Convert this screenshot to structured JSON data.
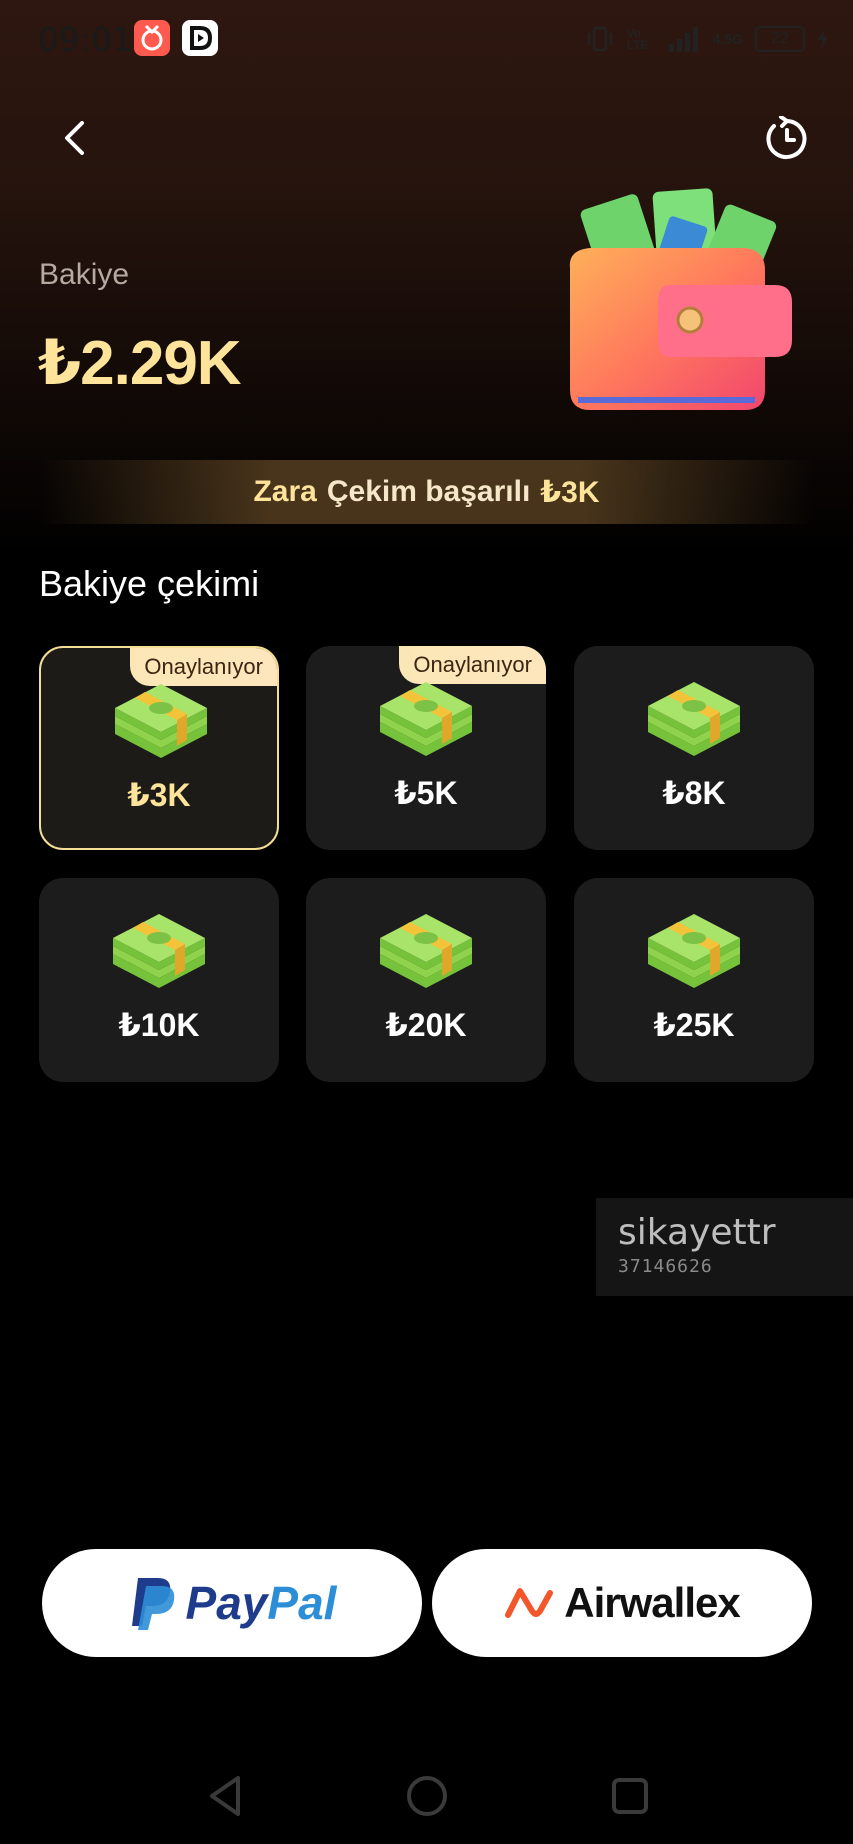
{
  "status_bar": {
    "time": "09:01",
    "network": "4.5G",
    "volte": "Vo LTE",
    "battery": "22"
  },
  "header": {
    "balance_label": "Bakiye",
    "balance_value": "₺2.29K"
  },
  "ticker": {
    "name": "Zara",
    "message": "Çekim başarılı",
    "amount": "₺3K"
  },
  "withdraw": {
    "title": "Bakiye çekimi",
    "options": [
      {
        "amount": "₺3K",
        "tag": "Onaylanıyor"
      },
      {
        "amount": "₺5K",
        "tag": "Onaylanıyor"
      },
      {
        "amount": "₺8K"
      },
      {
        "amount": "₺10K"
      },
      {
        "amount": "₺20K"
      },
      {
        "amount": "₺25K"
      }
    ]
  },
  "watermark": {
    "brand": "sikayettr",
    "id": "37146626"
  },
  "payment": {
    "paypal_part1": "Pay",
    "paypal_part2": "Pal",
    "airwallex": "Airwallex"
  },
  "colors": {
    "gold": "#fde49a",
    "paypal_blue": "#2c8ed6",
    "paypal_dark": "#1f3c8c",
    "airwallex_orange": "#f2572b"
  },
  "icons": {
    "back": "chevron-left-icon",
    "history": "history-clock-icon",
    "cash": "cash-stack-icon",
    "wallet": "wallet-icon"
  }
}
